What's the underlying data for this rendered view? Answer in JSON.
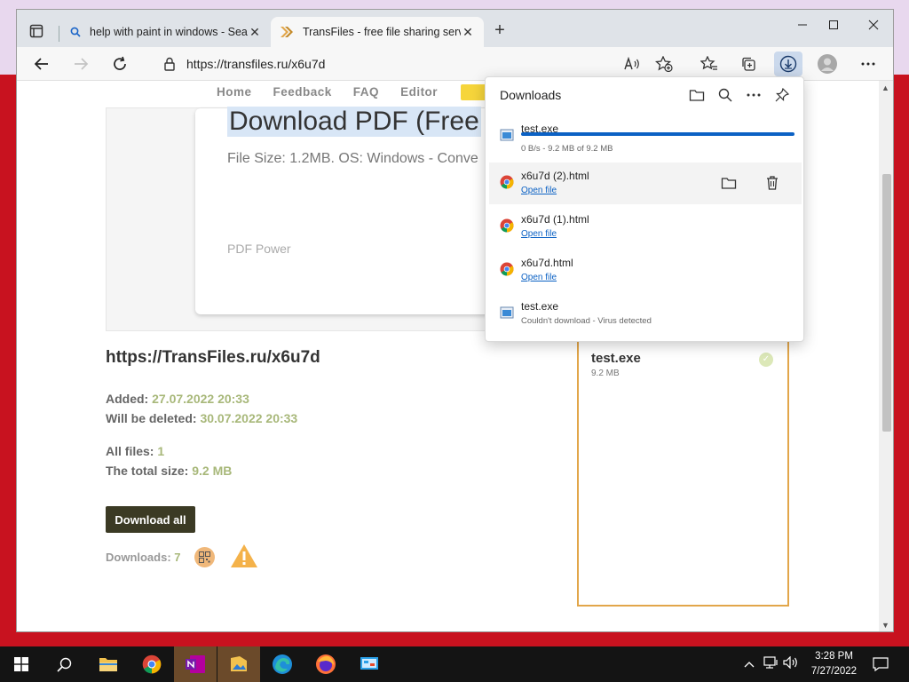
{
  "tabs": [
    {
      "title": "help with paint in windows - Sea",
      "close": "✕"
    },
    {
      "title": "TransFiles - free file sharing serv",
      "close": "✕"
    }
  ],
  "new_tab": "+",
  "address": {
    "url": "https://transfiles.ru/x6u7d"
  },
  "nav": [
    "Home",
    "Feedback",
    "FAQ",
    "Editor"
  ],
  "hero": {
    "title": "Download PDF (Free",
    "info": "File Size: 1.2MB. OS: Windows - Conve",
    "footer": "PDF Power"
  },
  "file_page": {
    "url": "https://TransFiles.ru/x6u7d",
    "added_label": "Added:",
    "added_value": "27.07.2022 20:33",
    "deleted_label": "Will be deleted:",
    "deleted_value": "30.07.2022 20:33",
    "all_files_label": "All files:",
    "all_files_value": "1",
    "total_size_label": "The total size:",
    "total_size_value": "9.2 MB",
    "download_all": "Download all",
    "downloads_label": "Downloads:",
    "downloads_value": "7"
  },
  "file_box": {
    "name": "test.exe",
    "size": "9.2 MB"
  },
  "downloads": {
    "title": "Downloads",
    "items": [
      {
        "name": "test.exe",
        "status": "0 B/s - 9.2 MB of 9.2 MB",
        "progress": 1.0
      },
      {
        "name": "x6u7d (2).html",
        "link": "Open file"
      },
      {
        "name": "x6u7d (1).html",
        "link": "Open file"
      },
      {
        "name": "x6u7d.html",
        "link": "Open file"
      },
      {
        "name": "test.exe",
        "status": "Couldn't download - Virus detected"
      }
    ]
  },
  "clock": {
    "time": "3:28 PM",
    "date": "7/27/2022"
  },
  "colors": {
    "accent": "#0b61c4",
    "file_box_border": "#e2a64a",
    "meta_value": "#a8b87a",
    "download_btn": "#3b3a24"
  }
}
